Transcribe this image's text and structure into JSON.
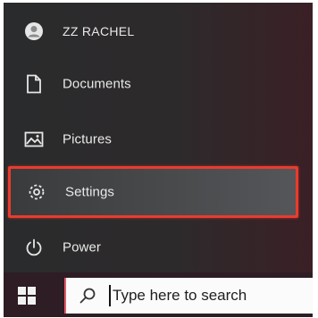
{
  "start_menu": {
    "user": {
      "label": "ZZ RACHEL",
      "icon": "user-avatar-icon"
    },
    "items": [
      {
        "label": "Documents",
        "icon": "document-icon"
      },
      {
        "label": "Pictures",
        "icon": "pictures-icon"
      },
      {
        "label": "Settings",
        "icon": "gear-icon",
        "highlighted": true,
        "highlight_color": "#ea3b2e"
      },
      {
        "label": "Power",
        "icon": "power-icon"
      }
    ]
  },
  "taskbar": {
    "start_icon": "windows-logo-icon",
    "search": {
      "placeholder": "Type here to search",
      "icon": "search-icon"
    }
  }
}
